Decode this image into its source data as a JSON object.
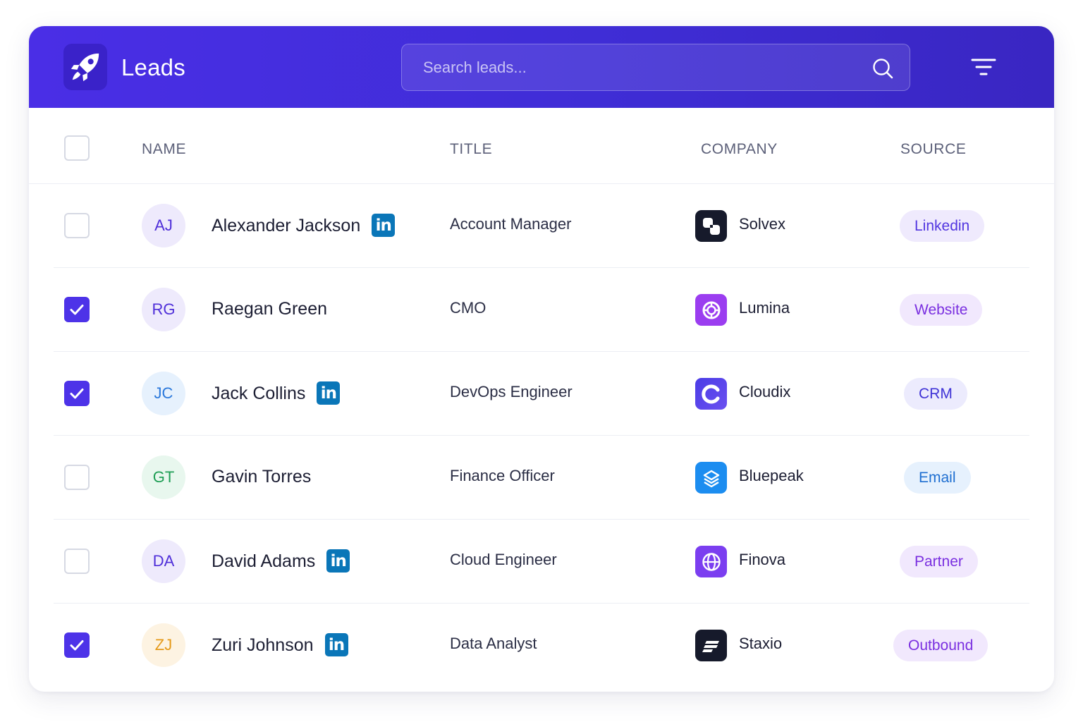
{
  "header": {
    "app_title": "Leads",
    "search_placeholder": "Search leads..."
  },
  "columns": {
    "name": "NAME",
    "title": "TITLE",
    "company": "COMPANY",
    "source": "SOURCE"
  },
  "colors": {
    "accent": "#4d33e8",
    "linkedin": "#0a76b8"
  },
  "rows": [
    {
      "initials": "AJ",
      "name": "Alexander Jackson",
      "linkedin": true,
      "title": "Account Manager",
      "company": "Solvex",
      "company_icon": "solvex-logo",
      "source": "Linkedin",
      "checked": false
    },
    {
      "initials": "RG",
      "name": "Raegan Green",
      "linkedin": false,
      "title": "CMO",
      "company": "Lumina",
      "company_icon": "lumina-logo",
      "source": "Website",
      "checked": true
    },
    {
      "initials": "JC",
      "name": "Jack Collins",
      "linkedin": true,
      "title": "DevOps Engineer",
      "company": "Cloudix",
      "company_icon": "cloudix-logo",
      "source": "CRM",
      "checked": true
    },
    {
      "initials": "GT",
      "name": "Gavin Torres",
      "linkedin": false,
      "title": "Finance Officer",
      "company": "Bluepeak",
      "company_icon": "bluepeak-logo",
      "source": "Email",
      "checked": false
    },
    {
      "initials": "DA",
      "name": "David Adams",
      "linkedin": true,
      "title": "Cloud Engineer",
      "company": "Finova",
      "company_icon": "finova-logo",
      "source": "Partner",
      "checked": false
    },
    {
      "initials": "ZJ",
      "name": "Zuri Johnson",
      "linkedin": true,
      "title": "Data Analyst",
      "company": "Staxio",
      "company_icon": "staxio-logo",
      "source": "Outbound",
      "checked": true
    }
  ]
}
